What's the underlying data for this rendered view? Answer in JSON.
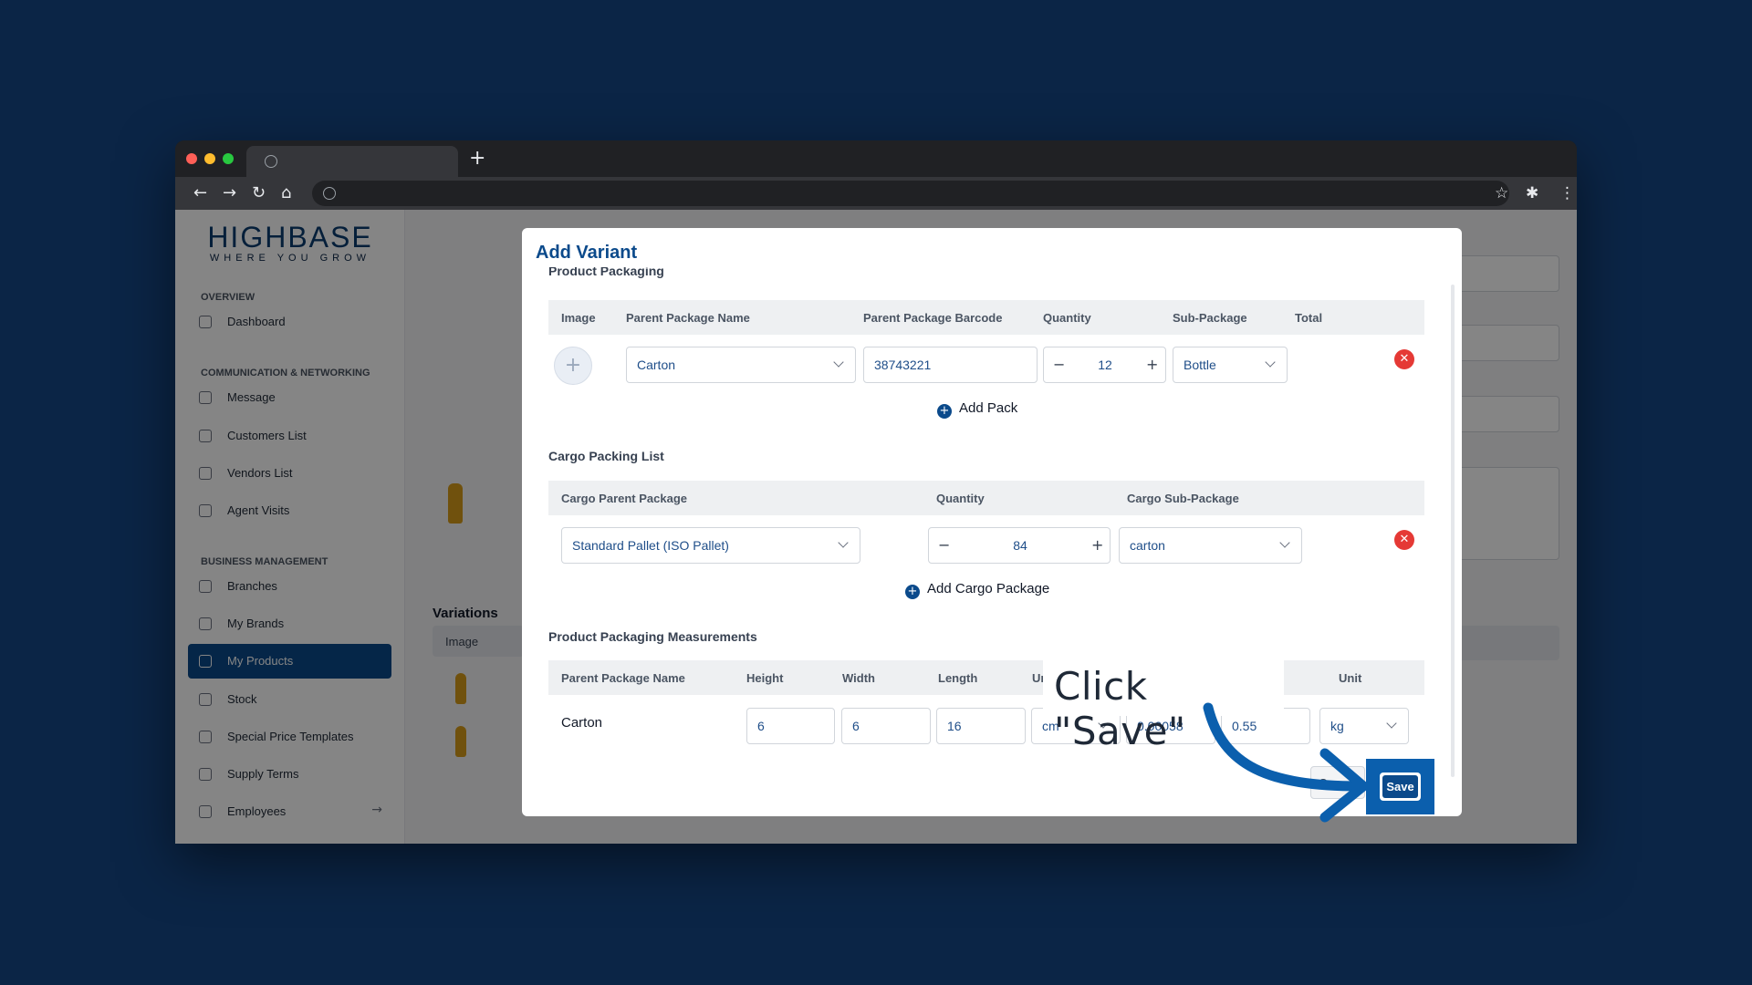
{
  "browser": {
    "new_tab_glyph": "+",
    "nav": {
      "back": "←",
      "forward": "→",
      "reload": "↻",
      "home": "⌂"
    },
    "toolbar_icons": [
      "star-icon",
      "extensions-icon",
      "menu-icon"
    ]
  },
  "logo": {
    "main": "HIGHBASE",
    "tagline": "WHERE YOU GROW"
  },
  "sidebar": {
    "sections": {
      "overview": "OVERVIEW",
      "communication": "COMMUNICATION & NETWORKING",
      "business": "BUSINESS MANAGEMENT"
    },
    "items": [
      {
        "label": "Dashboard",
        "icon": "home-icon"
      },
      {
        "label": "Message",
        "icon": "message-icon"
      },
      {
        "label": "Customers List",
        "icon": "users-icon"
      },
      {
        "label": "Vendors List",
        "icon": "users-icon"
      },
      {
        "label": "Agent Visits",
        "icon": "truck-icon"
      },
      {
        "label": "Branches",
        "icon": "building-icon"
      },
      {
        "label": "My Brands",
        "icon": "star-icon"
      },
      {
        "label": "My Products",
        "icon": "box-icon",
        "active": true
      },
      {
        "label": "Stock",
        "icon": "archive-icon"
      },
      {
        "label": "Special Price Templates",
        "icon": "list-icon"
      },
      {
        "label": "Supply Terms",
        "icon": "info-icon"
      },
      {
        "label": "Employees",
        "icon": "group-icon"
      }
    ]
  },
  "background": {
    "variations_title": "Variations",
    "variations_image_header": "Image"
  },
  "modal": {
    "title": "Add Variant",
    "product_packaging": {
      "title": "Product Packaging",
      "headers": [
        "Image",
        "Parent Package Name",
        "Parent Package Barcode",
        "Quantity",
        "Sub-Package",
        "Total"
      ],
      "row": {
        "parent_package": "Carton",
        "barcode": "38743221",
        "quantity": "12",
        "sub_package": "Bottle"
      },
      "add_label": "Add Pack"
    },
    "cargo": {
      "title": "Cargo Packing List",
      "headers": [
        "Cargo Parent Package",
        "Quantity",
        "Cargo Sub-Package"
      ],
      "row": {
        "parent_package": "Standard Pallet (ISO Pallet)",
        "quantity": "84",
        "sub_package": "carton"
      },
      "add_label": "Add Cargo Package"
    },
    "measurements": {
      "title": "Product Packaging Measurements",
      "headers": [
        "Parent Package Name",
        "Height",
        "Width",
        "Length",
        "Unit",
        "Unit"
      ],
      "row": {
        "name": "Carton",
        "height": "6",
        "width": "6",
        "length": "16",
        "dim_unit": "cm",
        "volume": "0.00058",
        "weight": "0.55",
        "weight_unit": "kg"
      }
    },
    "cancel_label": "Can",
    "save_label": "Save"
  },
  "callout": {
    "text": "Click \"Save\""
  },
  "colors": {
    "page_bg": "#0b2546",
    "accent": "#0b4a8b",
    "highlight": "#0b5fad",
    "danger": "#e53935"
  }
}
